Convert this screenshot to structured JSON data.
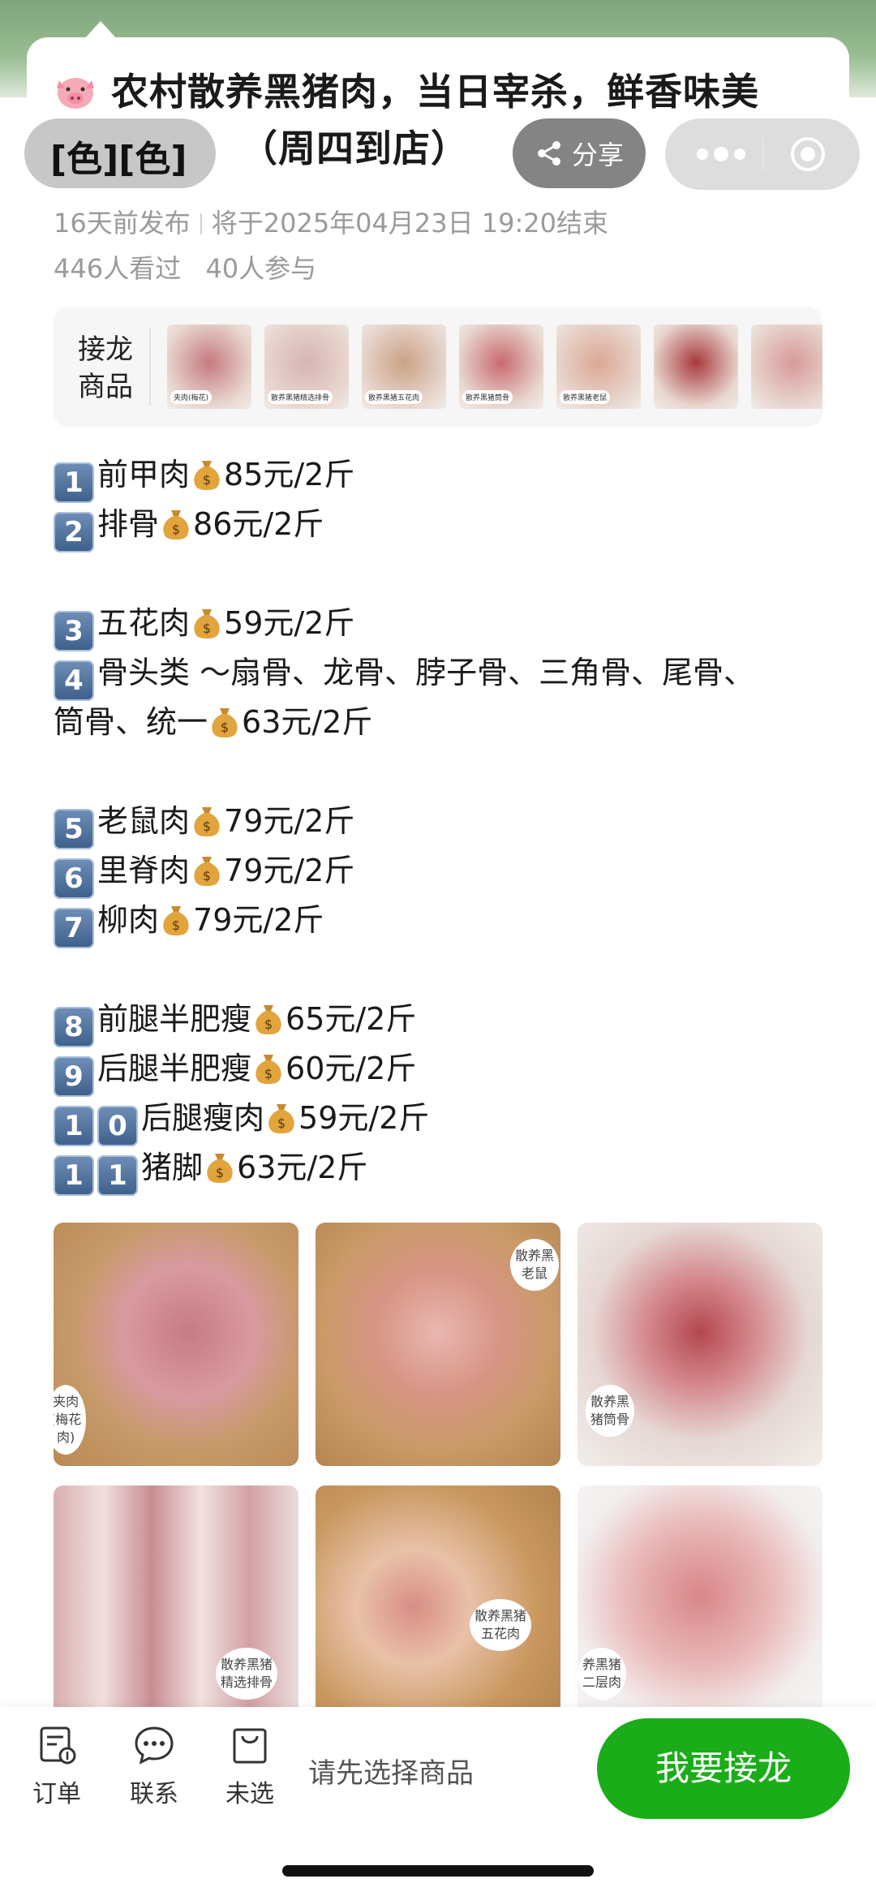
{
  "post": {
    "title_icon": "pig-face-icon",
    "title_line1": "农村散养黑猪肉，当日宰杀，鲜香味美",
    "title_line2": "（周四到店）",
    "overlay_text": "[色][色]",
    "published": "16天前发布",
    "ends_at": "将于2025年04月23日 19:20结束",
    "views": "446人看过",
    "participants": "40人参与"
  },
  "header": {
    "share_label": "分享",
    "share_icon": "share-icon",
    "more_icon": "more-dots-icon",
    "close_icon": "target-circle-icon"
  },
  "goods": {
    "label_line1": "接龙",
    "label_line2": "商品",
    "thumbs": [
      {
        "tag": "夹肉(梅花)",
        "color": "#c67a80"
      },
      {
        "tag": "散养黑猪精选排骨",
        "color": "#d7b4b4"
      },
      {
        "tag": "散养黑猪五花肉",
        "color": "#caa285"
      },
      {
        "tag": "散养黑猪筒骨",
        "color": "#c86a6f"
      },
      {
        "tag": "散养黑猪老鼠",
        "color": "#dca893"
      },
      {
        "tag": "",
        "color": "#a8393d"
      },
      {
        "tag": "",
        "color": "#d79a9a"
      }
    ]
  },
  "price_lines": [
    {
      "num": "1",
      "name": "前甲肉",
      "price": "85元/2斤"
    },
    {
      "num": "2",
      "name": "排骨",
      "price": "86元/2斤"
    },
    {
      "num": "3",
      "name": "五花肉",
      "price": "59元/2斤"
    },
    {
      "num": "4",
      "name": "骨头类 ～扇骨、龙骨、脖子骨、三角骨、尾骨、",
      "price": ""
    },
    {
      "num": "",
      "name": "筒骨、统一",
      "price": "63元/2斤"
    },
    {
      "num": "5",
      "name": "老鼠肉",
      "price": "79元/2斤"
    },
    {
      "num": "6",
      "name": "里脊肉",
      "price": "79元/2斤"
    },
    {
      "num": "7",
      "name": "柳肉",
      "price": "79元/2斤"
    },
    {
      "num": "8",
      "name": "前腿半肥瘦",
      "price": "65元/2斤"
    },
    {
      "num": "9",
      "name": "后腿半肥瘦",
      "price": "60元/2斤"
    },
    {
      "num": "10",
      "name": "后腿瘦肉",
      "price": "59元/2斤"
    },
    {
      "num": "11",
      "name": "猪脚",
      "price": "63元/2斤"
    }
  ],
  "photos": [
    {
      "tag": "夹肉\n(梅花\n肉)"
    },
    {
      "tag": "散养黑\n老鼠"
    },
    {
      "tag": "散养黑\n猪筒骨"
    },
    {
      "tag": "散养黑猪\n精选排骨"
    },
    {
      "tag": "散养黑猪\n五花肉"
    },
    {
      "tag": "养黑猪\n二层肉"
    }
  ],
  "bottom": {
    "orders_label": "订单",
    "contact_label": "联系",
    "unselected_label": "未选",
    "hint": "请先选择商品",
    "cta": "我要接龙"
  }
}
